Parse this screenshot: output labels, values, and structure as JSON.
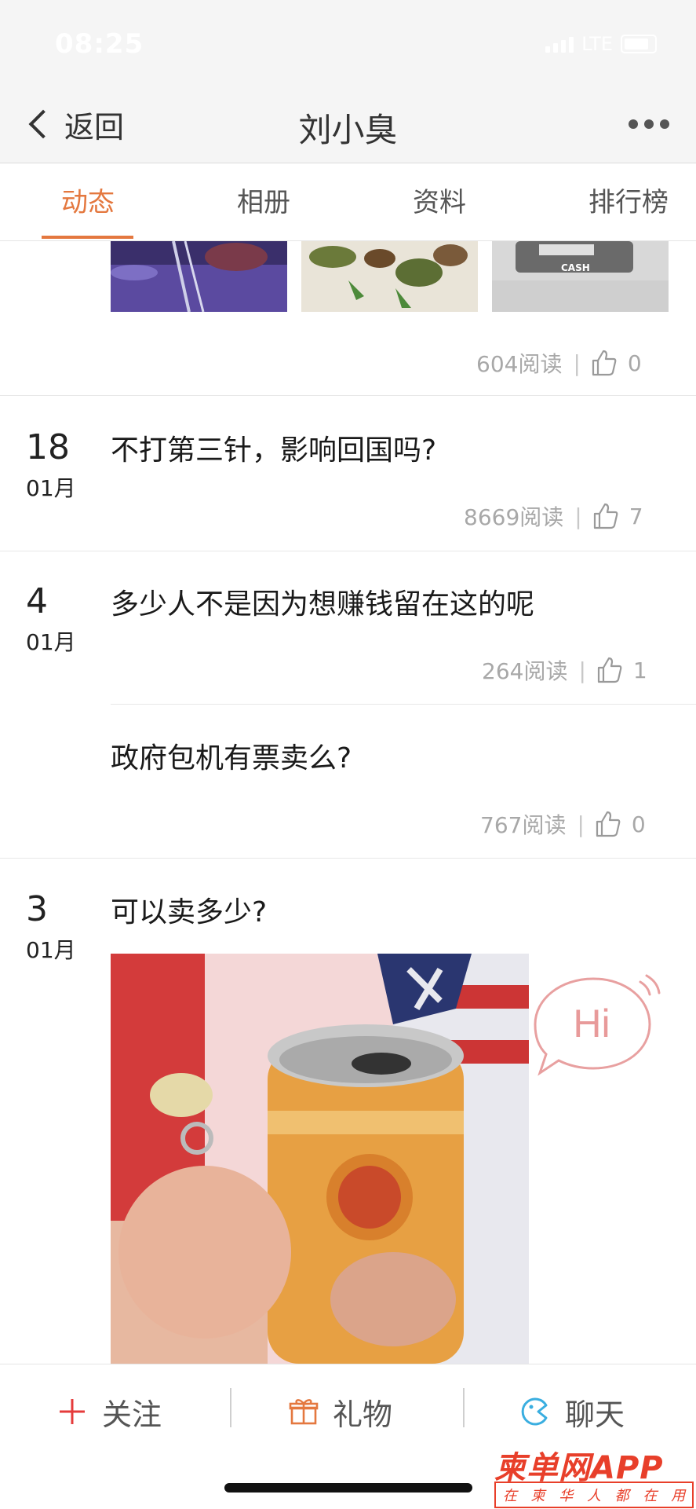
{
  "status": {
    "time": "08:25",
    "network": "LTE"
  },
  "nav": {
    "back_label": "返回",
    "title": "刘小臭"
  },
  "tabs": [
    {
      "label": "动态",
      "active": true
    },
    {
      "label": "相册"
    },
    {
      "label": "资料"
    },
    {
      "label": "排行榜"
    }
  ],
  "posts": [
    {
      "reads": "604阅读",
      "likes": "0"
    },
    {
      "day": "18",
      "month": "01月",
      "text": "不打第三针，影响回国吗?",
      "reads": "8669阅读",
      "likes": "7"
    },
    {
      "day": "4",
      "month": "01月",
      "text": "多少人不是因为想赚钱留在这的呢",
      "reads": "264阅读",
      "likes": "1"
    },
    {
      "text": "政府包机有票卖么?",
      "reads": "767阅读",
      "likes": "0"
    },
    {
      "day": "3",
      "month": "01月",
      "text": "可以卖多少?"
    }
  ],
  "hi_bubble": {
    "text": "Hi"
  },
  "bottom": {
    "follow_label": "关注",
    "gift_label": "礼物",
    "chat_label": "聊天"
  },
  "watermark": {
    "brand": "柬单网APP",
    "slogan": [
      "在",
      "柬",
      "华",
      "人",
      "都",
      "在",
      "用"
    ]
  },
  "colors": {
    "accent": "#e4783f",
    "follow_red": "#e53b3b",
    "chat_blue": "#3aaee0"
  }
}
